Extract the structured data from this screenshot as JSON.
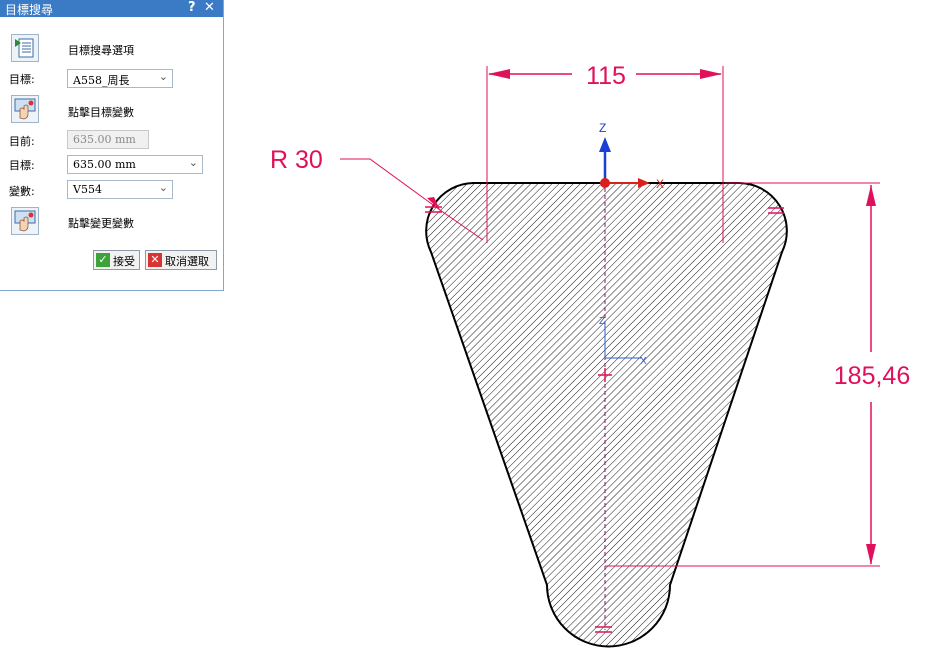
{
  "dialog": {
    "title": "目標搜尋",
    "help_glyph": "?",
    "close_glyph": "✕",
    "options_label": "目標搜尋選項",
    "target_label": "目標:",
    "target_select_value": "A558_周長",
    "click_target_variable_label": "點擊目標變數",
    "current_label": "目前:",
    "current_value": "635.00 mm",
    "goal_label": "目標:",
    "goal_value": "635.00 mm",
    "variable_label": "變數:",
    "variable_select_value": "V554",
    "click_change_variable_label": "點擊變更變數",
    "accept_label": "接受",
    "cancel_label": "取消選取"
  },
  "sketch": {
    "width_dimension": "115",
    "radius_dimension": "R 30",
    "height_dimension": "185,46",
    "axis_z_label": "Z",
    "axis_x_label": "X",
    "origin_z_label": "Z",
    "origin_x_label": "X"
  },
  "colors": {
    "titlebar": "#3b7ac4",
    "dimension": "#e0105a",
    "axis_z": "#1a3fd6",
    "axis_x": "#d9201f",
    "origin_axes": "#2a5bd7",
    "accept_icon": "#3fa33c",
    "cancel_icon": "#d83434"
  },
  "icons": [
    "options-list-icon",
    "hand-pick-icon",
    "hand-pick-icon",
    "checkmark-icon",
    "close-x-icon",
    "chevron-down-icon",
    "help-icon",
    "close-icon"
  ]
}
